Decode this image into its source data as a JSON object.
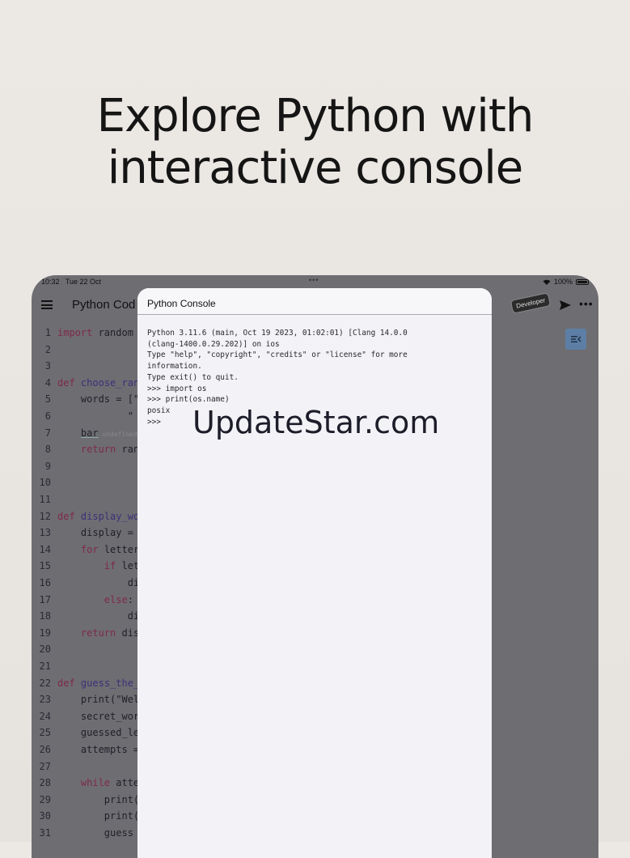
{
  "headline": {
    "line1": "Explore Python with",
    "line2": "interactive console"
  },
  "status_bar": {
    "time": "10:32",
    "date": "Tue 22 Oct",
    "dots": "•••",
    "battery": "100%"
  },
  "toolbar": {
    "title": "Python Cod",
    "badge": "Developer",
    "more": "•••"
  },
  "editor": {
    "lines": [
      {
        "n": "1",
        "t": "import random"
      },
      {
        "n": "2",
        "t": ""
      },
      {
        "n": "3",
        "t": ""
      },
      {
        "n": "4",
        "t": "def choose_ran"
      },
      {
        "n": "5",
        "t": "    words = [\""
      },
      {
        "n": "6",
        "t": "            \""
      },
      {
        "n": "7",
        "t": "    bar"
      },
      {
        "n": "8",
        "t": "    return ran"
      },
      {
        "n": "9",
        "t": ""
      },
      {
        "n": "10",
        "t": ""
      },
      {
        "n": "11",
        "t": ""
      },
      {
        "n": "12",
        "t": "def display_wo"
      },
      {
        "n": "13",
        "t": "    display = "
      },
      {
        "n": "14",
        "t": "    for letter"
      },
      {
        "n": "15",
        "t": "        if let"
      },
      {
        "n": "16",
        "t": "            di"
      },
      {
        "n": "17",
        "t": "        else:"
      },
      {
        "n": "18",
        "t": "            di"
      },
      {
        "n": "19",
        "t": "    return dis"
      },
      {
        "n": "20",
        "t": ""
      },
      {
        "n": "21",
        "t": ""
      },
      {
        "n": "22",
        "t": "def guess_the_"
      },
      {
        "n": "23",
        "t": "    print(\"Wel"
      },
      {
        "n": "24",
        "t": "    secret_wor"
      },
      {
        "n": "25",
        "t": "    guessed_le"
      },
      {
        "n": "26",
        "t": "    attempts ="
      },
      {
        "n": "27",
        "t": ""
      },
      {
        "n": "28",
        "t": "    while atte"
      },
      {
        "n": "29",
        "t": "        print("
      },
      {
        "n": "30",
        "t": "        print("
      },
      {
        "n": "31",
        "t": "        guess "
      }
    ],
    "hint": "undefined"
  },
  "console": {
    "title": "Python Console",
    "lines": [
      "Python 3.11.6 (main, Oct 19 2023, 01:02:01) [Clang 14.0.0",
      "(clang-1400.0.29.202)] on ios",
      "Type \"help\", \"copyright\", \"credits\" or \"license\" for more",
      "information.",
      "Type exit() to quit.",
      ">>> import os",
      ">>> print(os.name)",
      "posix",
      ">>>"
    ]
  },
  "watermark": "UpdateStar.com"
}
